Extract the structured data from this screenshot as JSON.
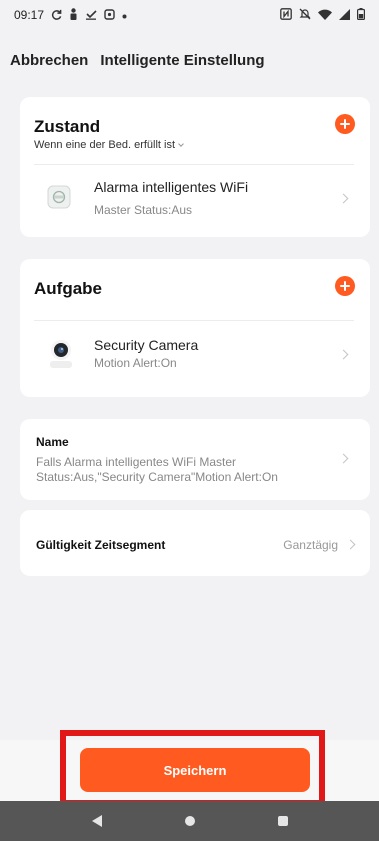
{
  "status_bar": {
    "time": "09:17",
    "left_icons": [
      "sync-icon",
      "person-icon",
      "download-check-icon",
      "notification-icon",
      "dot-icon"
    ],
    "right_icons": [
      "nfc-icon",
      "mute-icon",
      "wifi-icon",
      "signal-icon",
      "battery-icon"
    ]
  },
  "header": {
    "cancel_label": "Abbrechen",
    "title": "Intelligente Einstellung"
  },
  "condition": {
    "heading": "Zustand",
    "mode": "Wenn eine der Bed. erfüllt ist",
    "device_name": "Alarma intelligentes WiFi",
    "device_status": "Master Status:Aus"
  },
  "task": {
    "heading": "Aufgabe",
    "device_name": "Security Camera",
    "device_status": "Motion Alert:On"
  },
  "name_card": {
    "label": "Name",
    "value_line1": "Falls Alarma intelligentes WiFi Master",
    "value_line2": "Status:Aus,\"Security Camera\"Motion Alert:On"
  },
  "validity": {
    "label": "Gültigkeit Zeitsegment",
    "value": "Ganztägig"
  },
  "footer": {
    "save_label": "Speichern"
  },
  "colors": {
    "accent": "#ff5a1f",
    "highlight": "#e01818"
  }
}
